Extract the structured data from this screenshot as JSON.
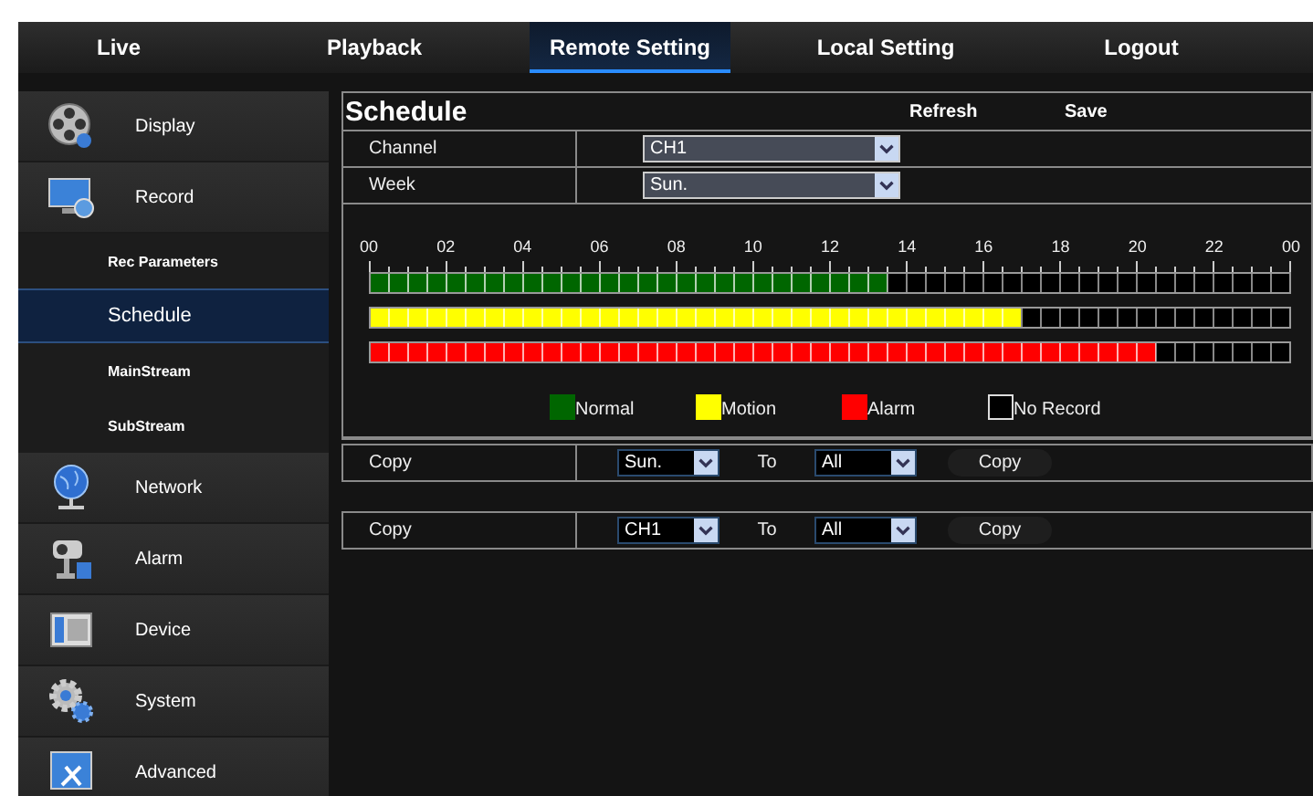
{
  "tabs": [
    {
      "label": "Live",
      "selected": false
    },
    {
      "label": "Playback",
      "selected": false
    },
    {
      "label": "Remote Setting",
      "selected": true
    },
    {
      "label": "Local Setting",
      "selected": false
    },
    {
      "label": "Logout",
      "selected": false
    }
  ],
  "sidebar": {
    "items": [
      {
        "label": "Display",
        "selected": false
      },
      {
        "label": "Record",
        "selected": false,
        "children": [
          {
            "label": "Rec Parameters",
            "selected": false
          },
          {
            "label": "Schedule",
            "selected": true
          },
          {
            "label": "MainStream",
            "selected": false
          },
          {
            "label": "SubStream",
            "selected": false
          }
        ]
      },
      {
        "label": "Network",
        "selected": false
      },
      {
        "label": "Alarm",
        "selected": false
      },
      {
        "label": "Device",
        "selected": false
      },
      {
        "label": "System",
        "selected": false
      },
      {
        "label": "Advanced",
        "selected": false
      }
    ]
  },
  "schedule": {
    "title": "Schedule",
    "actions": [
      "Refresh",
      "Save"
    ],
    "fields": [
      {
        "label": "Channel",
        "value": "CH1"
      },
      {
        "label": "Week",
        "value": "Sun."
      }
    ],
    "timeline": {
      "hour_labels": [
        "00",
        "02",
        "04",
        "06",
        "08",
        "10",
        "12",
        "14",
        "16",
        "18",
        "20",
        "22",
        "00"
      ],
      "rows": [
        {
          "color": "#006600",
          "level": 0.5625
        },
        {
          "color": "#ffff00",
          "level": 0.708333
        },
        {
          "color": "#ff0000",
          "level": 0.854167
        }
      ]
    },
    "legend": [
      {
        "label": "Normal",
        "color": "#006600",
        "kind": "fill"
      },
      {
        "label": "Motion",
        "color": "#ffff00",
        "kind": "fill"
      },
      {
        "label": "Alarm",
        "color": "#ff0000",
        "kind": "fill"
      },
      {
        "label": "No Record",
        "color": "#000000",
        "kind": "outline"
      }
    ],
    "copy_rows": [
      {
        "label": "Copy",
        "from": "Sun.",
        "to_label": "To",
        "to": "All",
        "button": "Copy"
      },
      {
        "label": "Copy",
        "from": "CH1",
        "to_label": "To",
        "to": "All",
        "button": "Copy"
      }
    ]
  }
}
